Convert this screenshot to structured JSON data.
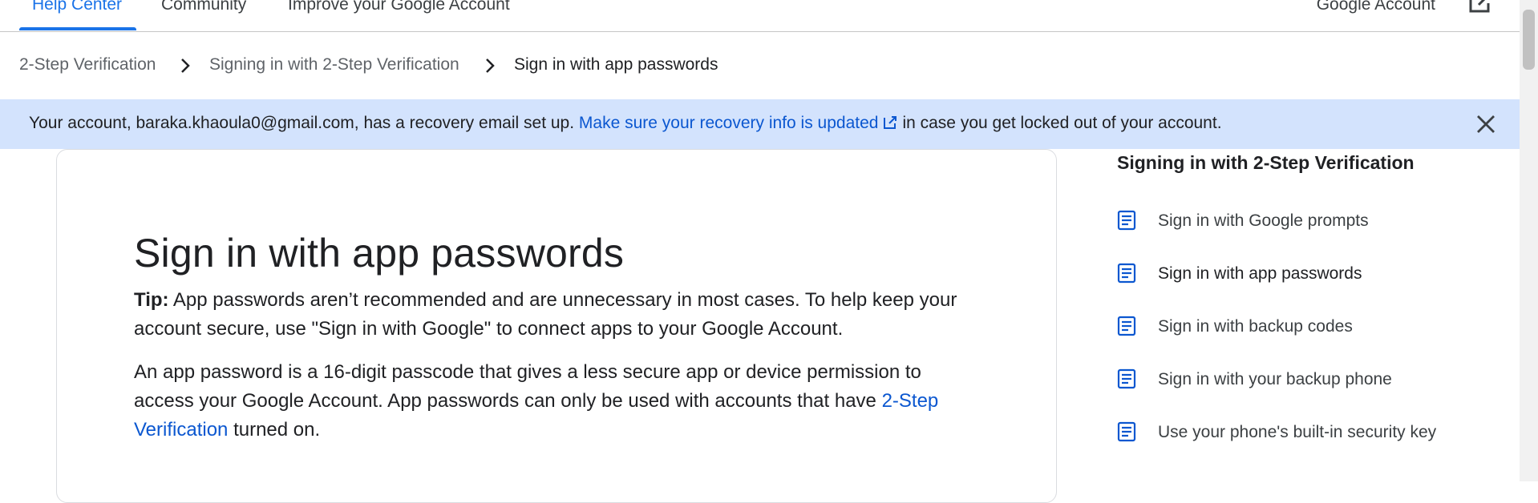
{
  "nav": {
    "tabs": [
      "Help Center",
      "Community",
      "Improve your Google Account"
    ],
    "account_link": "Google Account"
  },
  "breadcrumb": {
    "items": [
      "2-Step Verification",
      "Signing in with 2-Step Verification",
      "Sign in with app passwords"
    ]
  },
  "banner": {
    "text_before": "Your account, baraka.khaoula0@gmail.com, has a recovery email set up.",
    "link_text": "Make sure your recovery info is updated",
    "text_after": "in case you get locked out of your account."
  },
  "article": {
    "title": "Sign in with app passwords",
    "tip_label": "Tip:",
    "tip_text": "App passwords aren’t recommended and are unnecessary in most cases. To help keep your account secure, use \"Sign in with Google\" to connect apps to your Google Account.",
    "body_before": "An app password is a 16-digit passcode that gives a less secure app or device permission to access your Google Account. App passwords can only be used with accounts that have",
    "body_link": "2-Step Verification",
    "body_after": "turned on."
  },
  "sidebar": {
    "title": "Signing in with 2-Step Verification",
    "items": [
      "Sign in with Google prompts",
      "Sign in with app passwords",
      "Sign in with backup codes",
      "Sign in with your backup phone",
      "Use your phone's built-in security key"
    ]
  },
  "colors": {
    "link": "#0b57d0",
    "accent": "#1a73e8",
    "banner_bg": "#d3e3fd"
  }
}
